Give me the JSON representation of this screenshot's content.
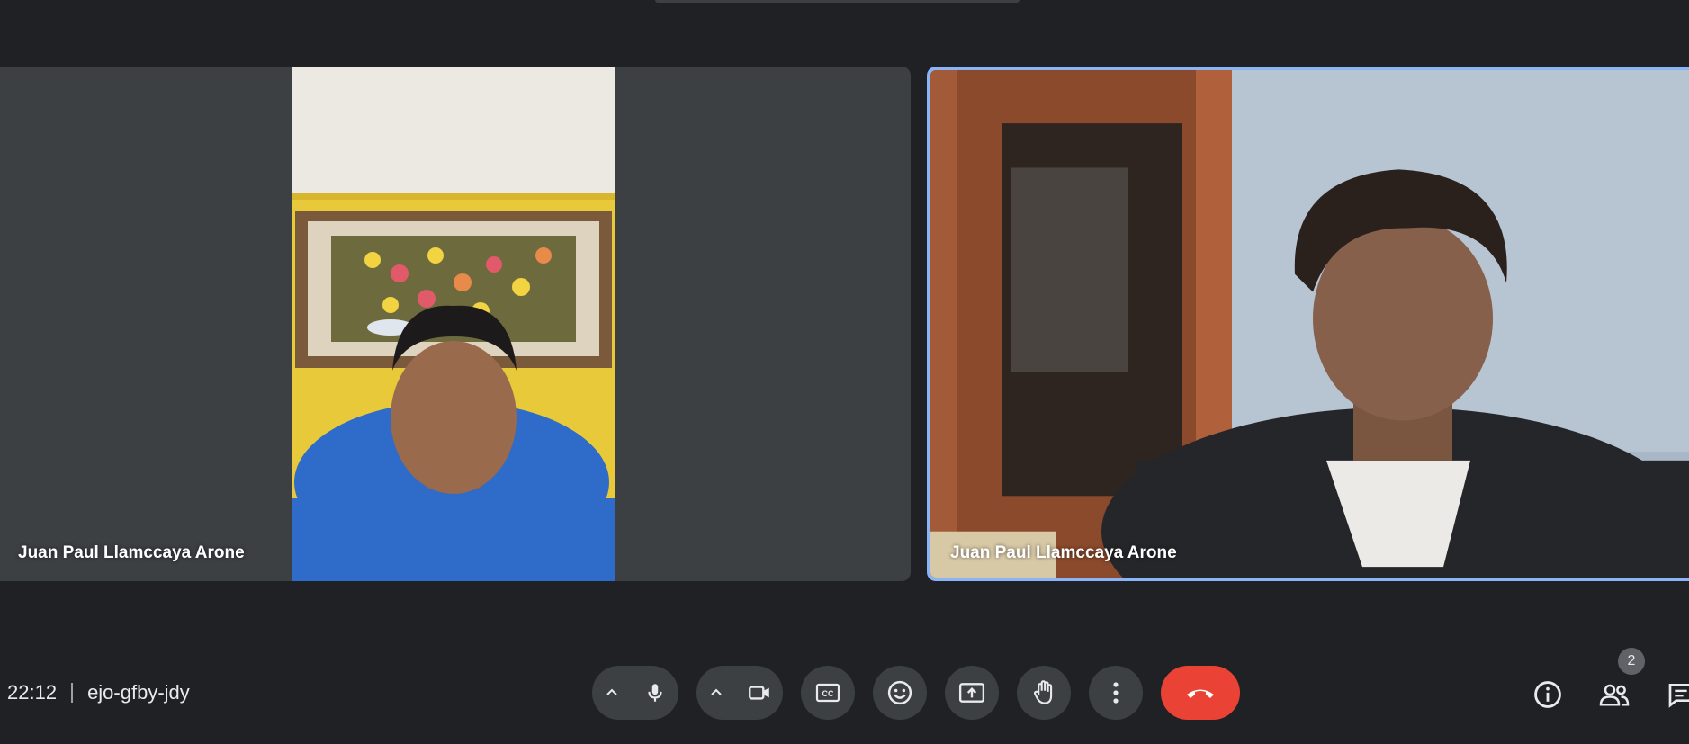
{
  "participants": [
    {
      "name": "Juan Paul Llamccaya Arone"
    },
    {
      "name": "Juan Paul Llamccaya Arone"
    }
  ],
  "meeting": {
    "time": "22:12",
    "code": "ejo-gfby-jdy"
  },
  "controls": {
    "mic_icon": "microphone-icon",
    "camera_icon": "camera-icon",
    "captions_icon": "closed-captions-icon",
    "reactions_icon": "emoji-icon",
    "present_icon": "present-screen-icon",
    "raise_hand_icon": "hand-icon",
    "more_icon": "more-vertical-icon",
    "end_call_icon": "end-call-icon"
  },
  "side": {
    "people_count": "2"
  },
  "colors": {
    "background": "#202124",
    "tile": "#3c4043",
    "active_border": "#8ab4f8",
    "end_call": "#ea4335"
  }
}
